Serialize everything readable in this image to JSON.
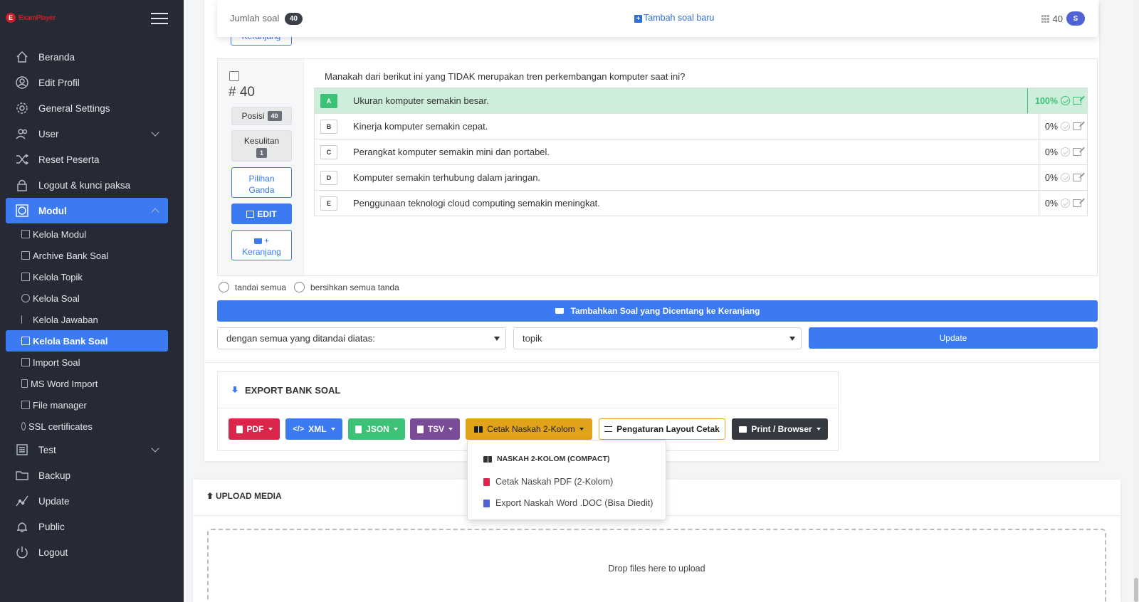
{
  "brand": {
    "logo_text": "ExamPlayer"
  },
  "sidebar": {
    "items": [
      {
        "label": "Beranda",
        "icon": "home-icon"
      },
      {
        "label": "Edit Profil",
        "icon": "user-circle-icon"
      },
      {
        "label": "General Settings",
        "icon": "gear-icon"
      },
      {
        "label": "User",
        "icon": "users-icon",
        "expandable": true
      },
      {
        "label": "Reset Peserta",
        "icon": "shuffle-icon"
      },
      {
        "label": "Logout & kunci paksa",
        "icon": "lock-icon"
      },
      {
        "label": "Modul",
        "icon": "module-icon",
        "expanded": true,
        "active": true
      },
      {
        "label": "Test",
        "icon": "list-icon",
        "expandable": true
      },
      {
        "label": "Backup",
        "icon": "folder-icon"
      },
      {
        "label": "Update",
        "icon": "chart-line-icon"
      },
      {
        "label": "Public",
        "icon": "bell-icon"
      },
      {
        "label": "Logout",
        "icon": "power-icon"
      }
    ],
    "sub_items": [
      "Kelola Modul",
      "Archive Bank Soal",
      "Kelola Topik",
      "Kelola Soal",
      "Kelola Jawaban",
      "Kelola Bank Soal",
      "Import Soal",
      "MS Word Import",
      "File manager",
      "SSL certificates"
    ],
    "active_sub": "Kelola Bank Soal"
  },
  "header": {
    "count_label": "Jumlah soal",
    "count_value": "40",
    "add_link": "Tambah soal baru",
    "right_value": "40",
    "right_badge": "S"
  },
  "prev_button": "Keranjang",
  "question": {
    "number": "# 40",
    "posisi_label": "Posisi",
    "posisi_value": "40",
    "kesulitan_label": "Kesulitan",
    "kesulitan_value": "1",
    "type_line1": "Pilihan",
    "type_line2": "Ganda",
    "edit_label": "EDIT",
    "cart_line1": "+",
    "cart_line2": "Keranjang",
    "text": "Manakah dari berikut ini yang TIDAK merupakan tren perkembangan komputer saat ini?",
    "answers": [
      {
        "letter": "A",
        "text": "Ukuran komputer semakin besar.",
        "score": "100%",
        "correct": true
      },
      {
        "letter": "B",
        "text": "Kinerja komputer semakin cepat.",
        "score": "0%",
        "correct": false
      },
      {
        "letter": "C",
        "text": "Perangkat komputer semakin mini dan portabel.",
        "score": "0%",
        "correct": false
      },
      {
        "letter": "D",
        "text": "Komputer semakin terhubung dalam jaringan.",
        "score": "0%",
        "correct": false
      },
      {
        "letter": "E",
        "text": "Penggunaan teknologi cloud computing semakin meningkat.",
        "score": "0%",
        "correct": false
      }
    ]
  },
  "marks": {
    "mark_all": "tandai semua",
    "clear_all": "bersihkan semua tanda"
  },
  "add_to_cart_button": "Tambahkan Soal yang Dicentang ke Keranjang",
  "bulk": {
    "action_select": "dengan semua yang ditandai diatas:",
    "field_select": "topik",
    "update_button": "Update"
  },
  "export": {
    "title": "EXPORT BANK SOAL",
    "buttons": [
      {
        "label": "PDF",
        "color": "#d9264a"
      },
      {
        "label": "XML",
        "color": "#3b7af0"
      },
      {
        "label": "JSON",
        "color": "#3cc277"
      },
      {
        "label": "TSV",
        "color": "#7a4c97"
      },
      {
        "label": "Cetak Naskah 2-Kolom",
        "color": "#e0a31a"
      },
      {
        "label": "Pengaturan Layout Cetak",
        "color": "#ffffff"
      },
      {
        "label": "Print / Browser",
        "color": "#343a40"
      }
    ],
    "dropdown": {
      "header": "NASKAH 2-KOLOM (COMPACT)",
      "item1": "Cetak Naskah PDF (2-Kolom)",
      "item2": "Export Naskah Word .DOC (Bisa Diedit)"
    }
  },
  "upload": {
    "title": "UPLOAD MEDIA",
    "dropzone_text": "Drop files here to upload"
  }
}
